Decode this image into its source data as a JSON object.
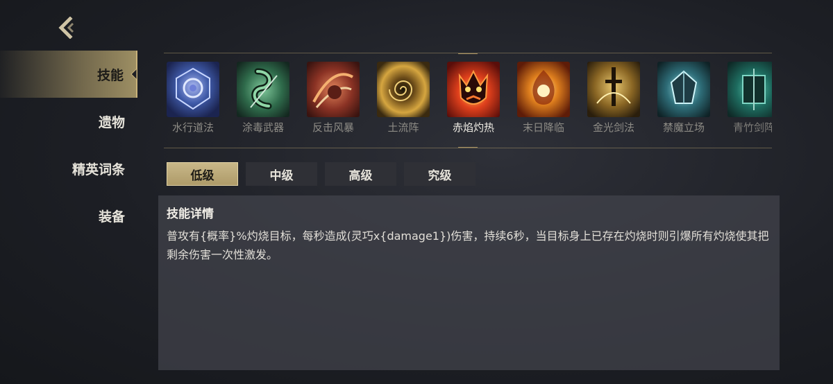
{
  "nav": {
    "back_icon": "back-chevron-icon"
  },
  "sidebar": {
    "items": [
      {
        "label": "技能",
        "active": true
      },
      {
        "label": "遗物",
        "active": false
      },
      {
        "label": "精英词条",
        "active": false
      },
      {
        "label": "装备",
        "active": false
      }
    ]
  },
  "skills": [
    {
      "name": "水行道法",
      "icon": "water-rune-icon"
    },
    {
      "name": "涂毒武器",
      "icon": "poison-serpent-icon"
    },
    {
      "name": "反击风暴",
      "icon": "counter-storm-icon"
    },
    {
      "name": "土流阵",
      "icon": "earth-vortex-icon"
    },
    {
      "name": "赤焰灼热",
      "icon": "crimson-flame-icon",
      "active": true
    },
    {
      "name": "末日降临",
      "icon": "doom-fire-icon"
    },
    {
      "name": "金光剑法",
      "icon": "golden-sword-icon"
    },
    {
      "name": "禁魔立场",
      "icon": "anti-magic-crystal-icon"
    },
    {
      "name": "青竹剑阵",
      "icon": "bamboo-sword-icon"
    }
  ],
  "tabs": [
    {
      "label": "低级",
      "active": true
    },
    {
      "label": "中级",
      "active": false
    },
    {
      "label": "高级",
      "active": false
    },
    {
      "label": "究级",
      "active": false
    }
  ],
  "detail": {
    "title": "技能详情",
    "description": "普攻有{概率}%灼烧目标，每秒造成(灵巧x{damage1})伤害，持续6秒，当目标身上已存在灼烧时则引爆所有灼烧使其把剩余伤害一次性激发。"
  },
  "colors": {
    "accent_gold": "#c9b27a",
    "tab_active": "#bfae7e",
    "panel_bg": "#42444c"
  }
}
